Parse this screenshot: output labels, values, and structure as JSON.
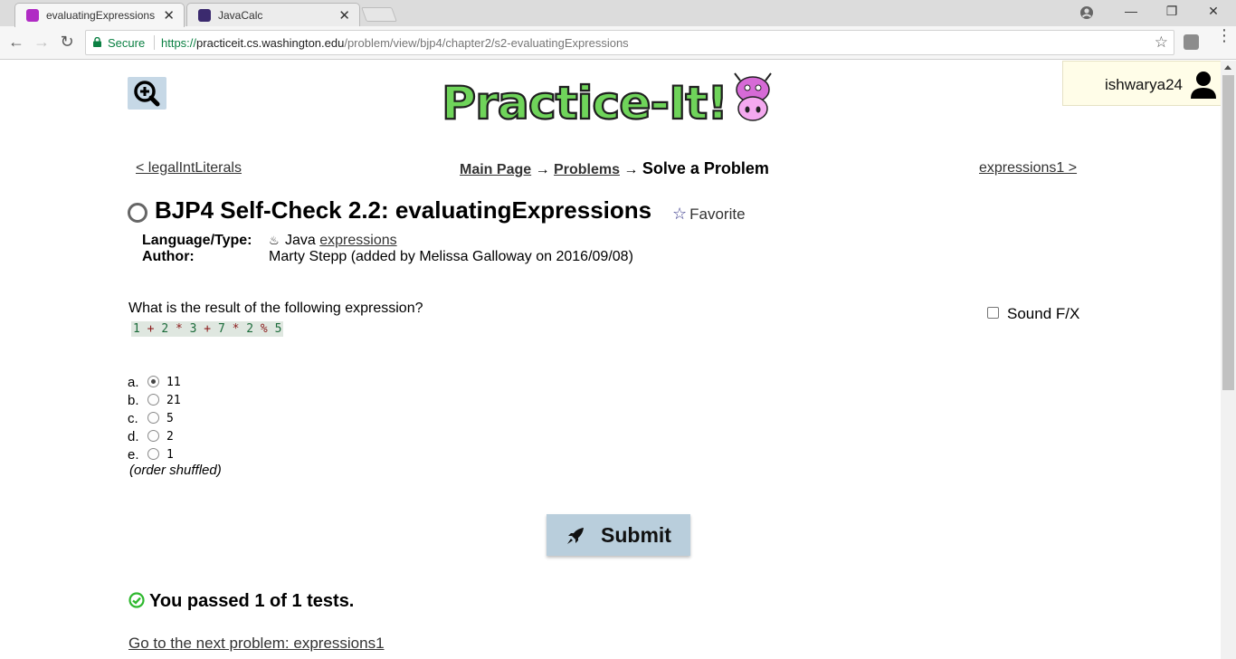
{
  "browser": {
    "tabs": [
      {
        "title": "evaluatingExpressions - S",
        "active": true
      },
      {
        "title": "JavaCalc",
        "active": false
      }
    ],
    "close_glyph": "✕",
    "window_controls": {
      "minimize": "—",
      "restore": "❐",
      "close": "✕"
    },
    "nav": {
      "back": "←",
      "forward": "→",
      "reload": "↻"
    },
    "secure_label": "Secure",
    "url": {
      "scheme": "https://",
      "host": "practiceit.cs.washington.edu",
      "path": "/problem/view/bjp4/chapter2/s2-evaluatingExpressions"
    },
    "bookmark_icon": "☆",
    "menu_icon": "⋮"
  },
  "header": {
    "logo_text": "Practice-It!",
    "username": "ishwarya24"
  },
  "navigation": {
    "prev_link": "< legalIntLiterals",
    "next_link": "expressions1 >",
    "breadcrumb": {
      "main_page": "Main Page",
      "arrow": "→",
      "problems": "Problems",
      "current": "Solve a Problem"
    }
  },
  "problem": {
    "title": "BJP4 Self-Check 2.2: evaluatingExpressions",
    "favorite_icon": "☆",
    "favorite_label": "Favorite",
    "language_label": "Language/Type:",
    "java_icon": "♨",
    "language": "Java",
    "type_link": "expressions",
    "author_label": "Author:",
    "author": "Marty Stepp (added by Melissa Galloway on 2016/09/08)",
    "question": "What is the result of the following expression?",
    "expression_tokens": [
      {
        "t": "1",
        "k": "n"
      },
      {
        "t": " + ",
        "k": "o"
      },
      {
        "t": "2",
        "k": "n"
      },
      {
        "t": " * ",
        "k": "o"
      },
      {
        "t": "3",
        "k": "n"
      },
      {
        "t": " + ",
        "k": "o"
      },
      {
        "t": "7",
        "k": "n"
      },
      {
        "t": " * ",
        "k": "o"
      },
      {
        "t": "2",
        "k": "n"
      },
      {
        "t": " % ",
        "k": "o"
      },
      {
        "t": "5",
        "k": "n"
      }
    ],
    "sound_label": "Sound F/X",
    "choices": [
      {
        "letter": "a.",
        "value": "11",
        "selected": true
      },
      {
        "letter": "b.",
        "value": "21",
        "selected": false
      },
      {
        "letter": "c.",
        "value": "5",
        "selected": false
      },
      {
        "letter": "d.",
        "value": "2",
        "selected": false
      },
      {
        "letter": "e.",
        "value": "1",
        "selected": false
      }
    ],
    "shuffled_note": "(order shuffled)",
    "submit_label": "Submit"
  },
  "result": {
    "passed_text": "You passed 1 of 1 tests.",
    "next_problem_link": "Go to the next problem: expressions1"
  },
  "colors": {
    "submit_bg": "#b9cedc",
    "pass_green": "#2eb82e",
    "secure_green": "#0b8043"
  }
}
